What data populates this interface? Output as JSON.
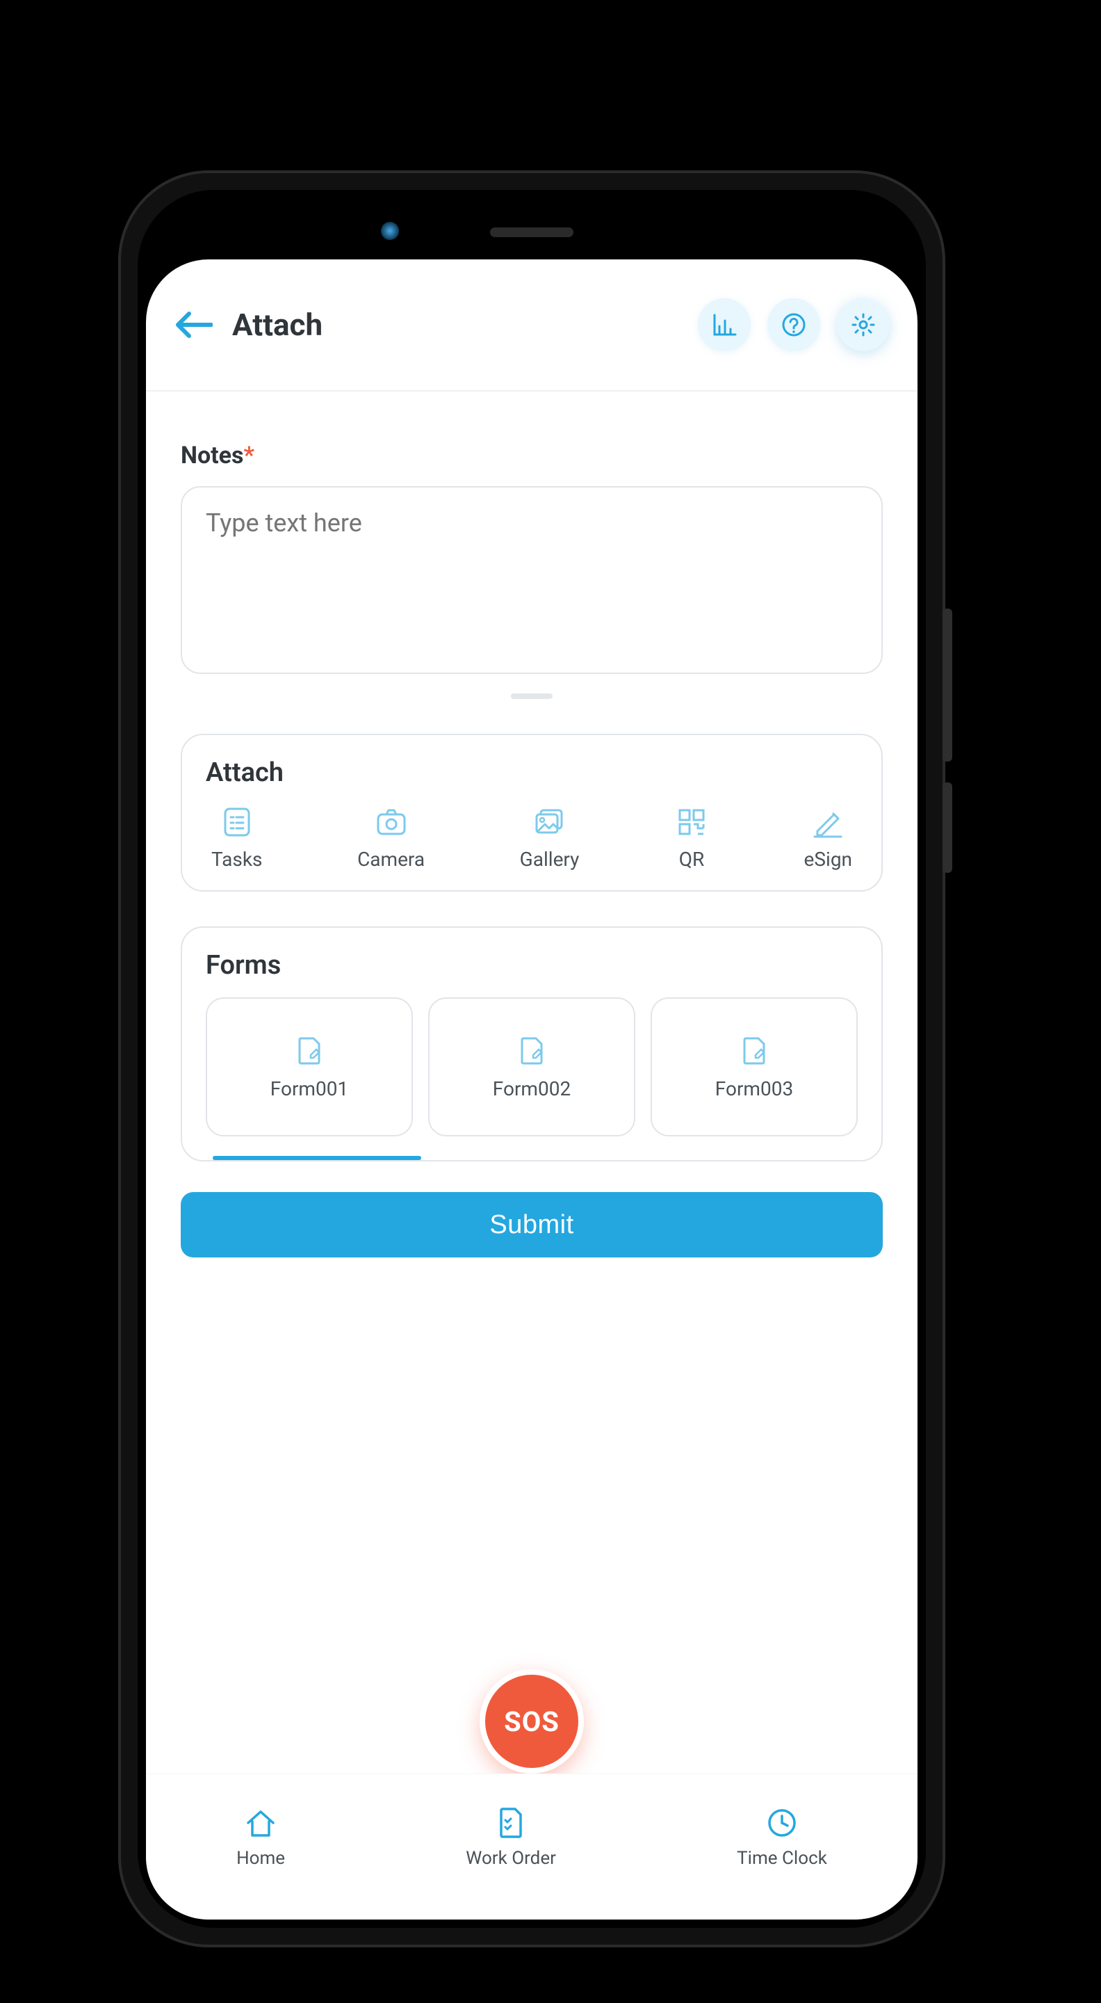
{
  "header": {
    "title": "Attach"
  },
  "notes": {
    "label": "Notes",
    "required_mark": "*",
    "placeholder": "Type text here"
  },
  "attach": {
    "title": "Attach",
    "items": [
      {
        "label": "Tasks"
      },
      {
        "label": "Camera"
      },
      {
        "label": "Gallery"
      },
      {
        "label": "QR"
      },
      {
        "label": "eSign"
      }
    ]
  },
  "forms": {
    "title": "Forms",
    "items": [
      {
        "label": "Form001"
      },
      {
        "label": "Form002"
      },
      {
        "label": "Form003"
      }
    ]
  },
  "submit_label": "Submit",
  "sos_label": "SOS",
  "nav": {
    "items": [
      {
        "label": "Home"
      },
      {
        "label": "Work Order"
      },
      {
        "label": "Time Clock"
      }
    ]
  },
  "colors": {
    "primary": "#24a7df",
    "accent_red": "#f05a3c"
  }
}
